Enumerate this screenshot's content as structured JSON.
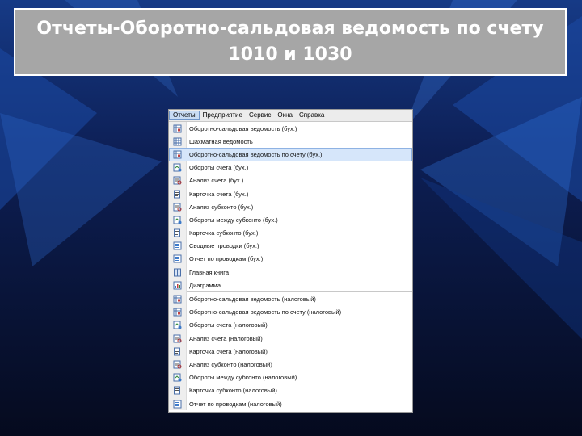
{
  "slide": {
    "title": "Отчеты-Оборотно-сальдовая ведомость по счету 1010 и 1030"
  },
  "colors": {
    "background": "#0a1230",
    "title_box": "#a6a6a6",
    "highlight": "#d6e6fa"
  },
  "menubar": {
    "items": [
      "Отчеты",
      "Предприятие",
      "Сервис",
      "Окна",
      "Справка"
    ]
  },
  "menu": {
    "items": [
      {
        "label": "Оборотно-сальдовая ведомость (бух.)",
        "icon": "report-table-icon"
      },
      {
        "label": "Шахматная ведомость",
        "icon": "grid-report-icon"
      },
      {
        "label": "Оборотно-сальдовая ведомость по счету (бух.)",
        "icon": "report-table-icon"
      },
      {
        "label": "Обороты счета (бух.)",
        "icon": "turnover-icon"
      },
      {
        "label": "Анализ счета (бух.)",
        "icon": "analysis-icon"
      },
      {
        "label": "Карточка счета (бух.)",
        "icon": "card-icon"
      },
      {
        "label": "Анализ субконто (бух.)",
        "icon": "analysis-icon"
      },
      {
        "label": "Обороты между субконто (бух.)",
        "icon": "turnover-icon"
      },
      {
        "label": "Карточка субконто (бух.)",
        "icon": "card-icon"
      },
      {
        "label": "Сводные проводки (бух.)",
        "icon": "entries-icon"
      },
      {
        "label": "Отчет по проводкам (бух.)",
        "icon": "entries-icon"
      },
      {
        "label": "Главная книга",
        "icon": "ledger-icon"
      },
      {
        "label": "Диаграмма",
        "icon": "chart-icon"
      },
      {
        "label": "Оборотно-сальдовая ведомость (налоговый)",
        "icon": "report-table-icon"
      },
      {
        "label": "Оборотно-сальдовая ведомость по счету (налоговый)",
        "icon": "report-table-icon"
      },
      {
        "label": "Обороты счета (налоговый)",
        "icon": "turnover-icon"
      },
      {
        "label": "Анализ счета (налоговый)",
        "icon": "analysis-icon"
      },
      {
        "label": "Карточка счета (налоговый)",
        "icon": "card-icon"
      },
      {
        "label": "Анализ субконто (налоговый)",
        "icon": "analysis-icon"
      },
      {
        "label": "Обороты между субконто (налоговый)",
        "icon": "turnover-icon"
      },
      {
        "label": "Карточка субконто (налоговый)",
        "icon": "card-icon"
      },
      {
        "label": "Отчет по проводкам (налоговый)",
        "icon": "entries-icon"
      }
    ],
    "highlighted_item": "Оборотно-сальдовая ведомость по счету (бух.)"
  }
}
